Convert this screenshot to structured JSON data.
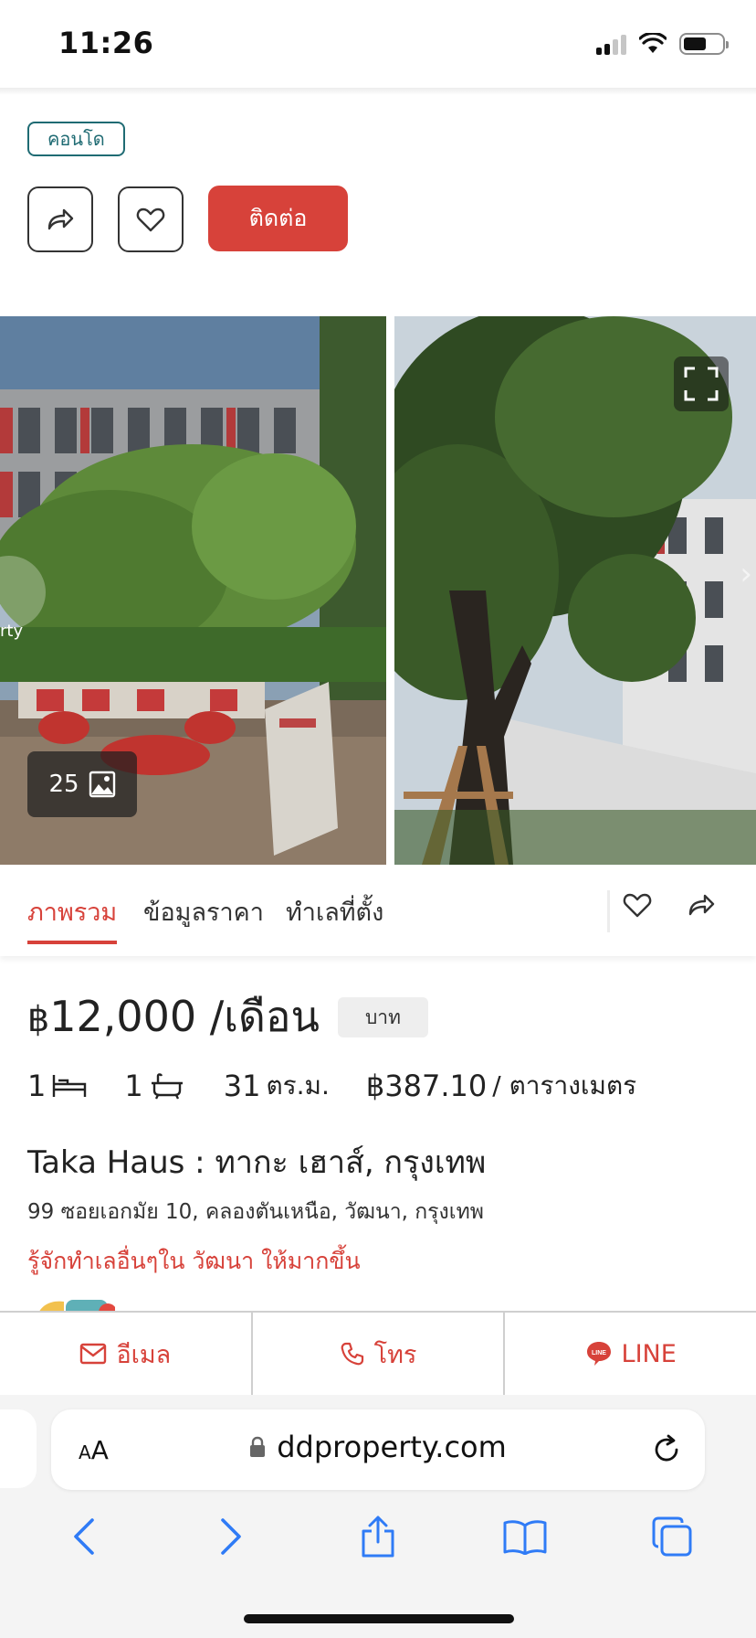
{
  "status_bar": {
    "time": "11:26"
  },
  "listing": {
    "type_badge": "คอนโด",
    "contact_button": "ติดต่อ",
    "photo_count": "25",
    "prev_arrow_label": "rty"
  },
  "tabs": [
    {
      "label": "ภาพรวม",
      "active": true
    },
    {
      "label": "ข้อมูลราคา",
      "active": false
    },
    {
      "label": "ทำเลที่ตั้ง",
      "active": false
    }
  ],
  "price": {
    "currency_symbol": "฿",
    "amount": "12,000",
    "period": "/เดือน",
    "currency_badge": "บาท"
  },
  "specs": {
    "bedrooms": "1",
    "bathrooms": "1",
    "area": "31",
    "area_unit": "ตร.ม.",
    "price_per_area": "฿387.10",
    "price_per_area_unit": "/ ตารางเมตร"
  },
  "project": {
    "title": "Taka Haus : ทากะ เฮาส์, กรุงเทพ",
    "address": "99 ซอยเอกมัย 10, คลองตันเหนือ, วัฒนา, กรุงเทพ",
    "area_link": "รู้จักทำเลอื่นๆใน วัฒนา ให้มากขึ้น"
  },
  "actions": {
    "email": "อีเมล",
    "call": "โทร",
    "line": "LINE"
  },
  "browser": {
    "aa_label": "AA",
    "url": "ddproperty.com"
  },
  "colors": {
    "accent": "#d7423a",
    "badge_teal": "#1f6b73",
    "browser_blue": "#2f7bf6"
  },
  "icons": [
    "share-icon",
    "heart-icon",
    "image-icon",
    "expand-icon",
    "bed-icon",
    "bath-icon",
    "mail-icon",
    "phone-icon",
    "line-icon",
    "lock-icon",
    "reload-icon",
    "back-icon",
    "forward-icon",
    "share-sheet-icon",
    "bookmarks-icon",
    "tabs-icon"
  ]
}
